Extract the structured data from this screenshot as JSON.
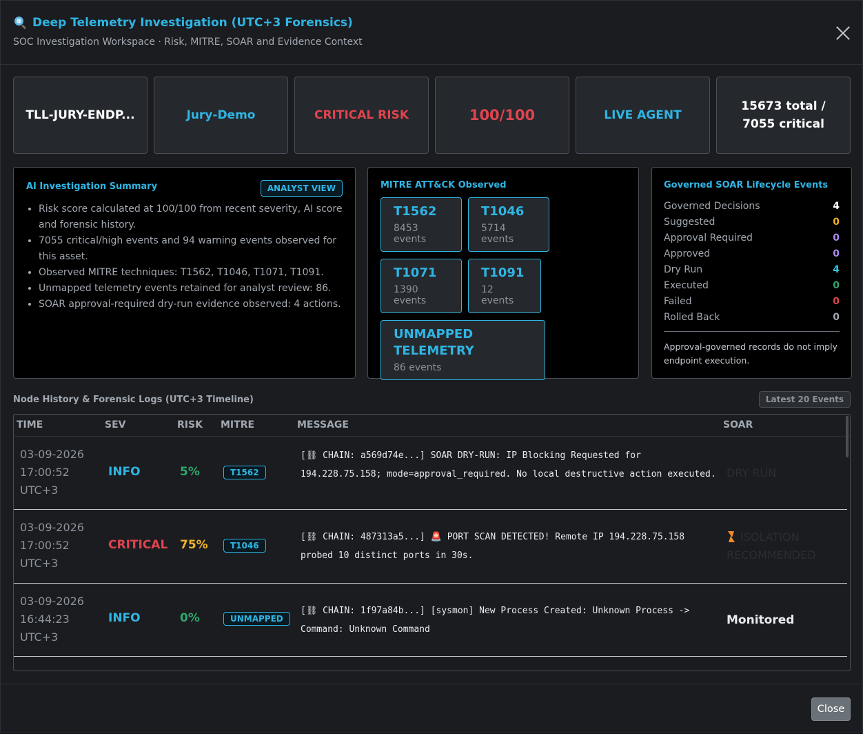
{
  "header": {
    "title": "Deep Telemetry Investigation (UTC+3 Forensics)",
    "subtitle": "SOC Investigation Workspace · Risk, MITRE, SOAR and Evidence Context",
    "icon": "magnifier-icon"
  },
  "stats": {
    "host": "TLL-JURY-ENDP...",
    "group": "Jury-Demo",
    "risk_level": "CRITICAL RISK",
    "score": "100/100",
    "agent": "LIVE AGENT",
    "events": "15673 total / 7055 critical"
  },
  "ai_summary": {
    "title": "AI Investigation Summary",
    "badge": "ANALYST VIEW",
    "items": [
      "Risk score calculated at 100/100 from recent severity, AI score and forensic history.",
      "7055 critical/high events and 94 warning events observed for this asset.",
      "Observed MITRE techniques: T1562, T1046, T1071, T1091.",
      "Unmapped telemetry events retained for analyst review: 86.",
      "SOAR approval-required dry-run evidence observed: 4 actions."
    ]
  },
  "mitre": {
    "title": "MITRE ATT&CK Observed",
    "techniques": [
      {
        "code": "T1562",
        "count": "8453 events"
      },
      {
        "code": "T1046",
        "count": "5714 events"
      },
      {
        "code": "T1071",
        "count": "1390 events"
      },
      {
        "code": "T1091",
        "count": "12 events"
      },
      {
        "code": "UNMAPPED TELEMETRY",
        "count": "86 events"
      }
    ]
  },
  "soar": {
    "title": "Governed SOAR Lifecycle Events",
    "rows": [
      {
        "label": "Governed Decisions",
        "value": "4",
        "color": "#ffffff"
      },
      {
        "label": "Suggested",
        "value": "0",
        "color": "#f0b429"
      },
      {
        "label": "Approval Required",
        "value": "0",
        "color": "#b18cf0"
      },
      {
        "label": "Approved",
        "value": "0",
        "color": "#b18cf0"
      },
      {
        "label": "Dry Run",
        "value": "4",
        "color": "#2fc7d8"
      },
      {
        "label": "Executed",
        "value": "0",
        "color": "#2ea86a"
      },
      {
        "label": "Failed",
        "value": "0",
        "color": "#e0444e"
      },
      {
        "label": "Rolled Back",
        "value": "0",
        "color": "#a2a8b0"
      }
    ],
    "note": "Approval-governed records do not imply endpoint execution."
  },
  "history": {
    "title": "Node History & Forensic Logs (UTC+3 Timeline)",
    "badge": "Latest 20 Events",
    "columns": {
      "time": "TIME",
      "sev": "SEV",
      "risk": "RISK",
      "mitre": "MITRE",
      "message": "MESSAGE",
      "soar": "SOAR"
    },
    "rows": [
      {
        "date": "03-09-2026",
        "clock": "17:00:52",
        "tz": "UTC+3",
        "sev": "INFO",
        "risk": "5%",
        "mitre": "T1562",
        "message": "[⛓ CHAIN: a569d74e...] SOAR DRY-RUN: IP Blocking Requested for 194.228.75.158; mode=approval_required. No local destructive action executed.",
        "soar": "DRY RUN"
      },
      {
        "date": "03-09-2026",
        "clock": "17:00:52",
        "tz": "UTC+3",
        "sev": "CRITICAL",
        "risk": "75%",
        "mitre": "T1046",
        "message": "[⛓ CHAIN: 487313a5...] 🚨 PORT SCAN DETECTED! Remote IP 194.228.75.158 probed 10 distinct ports in 30s.",
        "soar": "ISOLATION RECOMMENDED"
      },
      {
        "date": "03-09-2026",
        "clock": "16:44:23",
        "tz": "UTC+3",
        "sev": "INFO",
        "risk": "0%",
        "mitre": "UNMAPPED",
        "message": "[⛓ CHAIN: 1f97a84b...] [sysmon] New Process Created: Unknown Process -> Command: Unknown Command",
        "soar": "Monitored"
      }
    ],
    "ghost_date": "03-09-2026"
  },
  "footer": {
    "close_label": "Close"
  }
}
